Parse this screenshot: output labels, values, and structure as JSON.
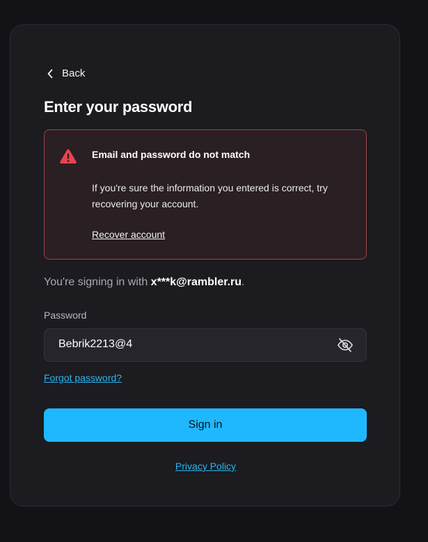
{
  "nav": {
    "back_label": "Back",
    "back_icon": "chevron-left-icon"
  },
  "page": {
    "title": "Enter your password"
  },
  "alert": {
    "icon": "warning-triangle-icon",
    "title": "Email and password do not match",
    "body": "If you're sure the information you entered is correct, try recovering your account.",
    "link_label": "Recover account",
    "colors": {
      "border": "#a0424b",
      "background": "#2a1f23",
      "icon": "#e8434f"
    }
  },
  "signing": {
    "prefix": "You're signing in with ",
    "email": "x***k@rambler.ru",
    "suffix": "."
  },
  "password": {
    "label": "Password",
    "value": "Bebrik2213@4",
    "toggle_icon": "eye-off-icon"
  },
  "links": {
    "forgot": "Forgot password?",
    "privacy": "Privacy Policy"
  },
  "actions": {
    "sign_in_label": "Sign in"
  },
  "colors": {
    "accent": "#1fb8ff",
    "link": "#2ab6f0",
    "card": "#1b1b20",
    "page": "#121217"
  }
}
